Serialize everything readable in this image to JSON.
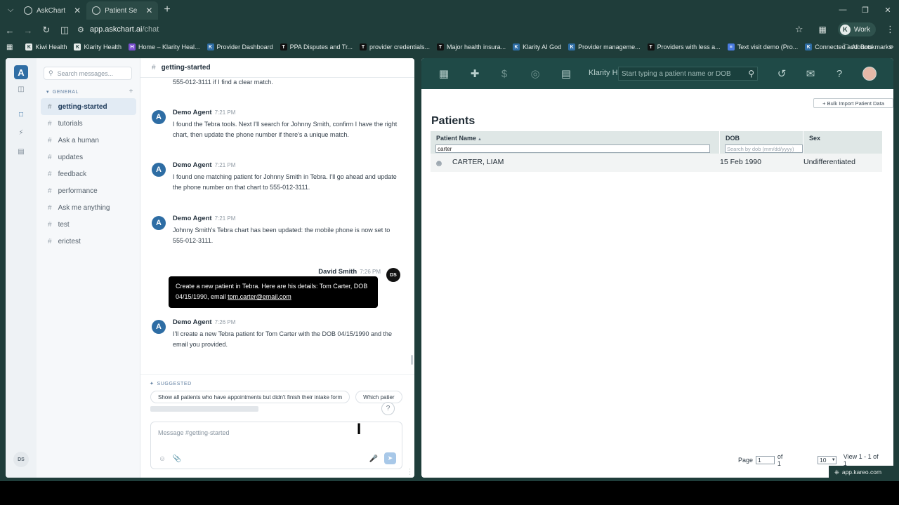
{
  "browser": {
    "tabs": [
      {
        "label": "AskChart",
        "active": false
      },
      {
        "label": "Patient Se",
        "active": true
      }
    ],
    "url_host": "app.askchart.ai",
    "url_path": "/chat",
    "profile_label": "Work",
    "profile_initial": "K",
    "bookmarks": [
      "Kiwi Health",
      "Klarity Health",
      "Home – Klarity Heal...",
      "Provider Dashboard",
      "PPA Disputes and Tr...",
      "provider credentials...",
      "Major health insura...",
      "Klarity AI God",
      "Provider manageme...",
      "Providers with less a...",
      "Text visit demo (Pro...",
      "Connected accounts"
    ],
    "all_bookmarks": "All Bookmarks",
    "status_url": "app.kareo.com"
  },
  "askchart": {
    "logo": "A",
    "user_initials": "DS",
    "search_placeholder": "Search messages...",
    "group_label": "GENERAL",
    "channels": [
      {
        "name": "getting-started",
        "active": true
      },
      {
        "name": "tutorials",
        "active": false
      },
      {
        "name": "Ask a human",
        "active": false
      },
      {
        "name": "updates",
        "active": false
      },
      {
        "name": "feedback",
        "active": false
      },
      {
        "name": "performance",
        "active": false
      },
      {
        "name": "Ask me anything",
        "active": false
      },
      {
        "name": "test",
        "active": false
      },
      {
        "name": "erictest",
        "active": false
      }
    ],
    "channel_title": "getting-started",
    "fragment": "555-012-3111 if I find a clear match.",
    "messages": [
      {
        "author": "Demo Agent",
        "time": "7:21 PM",
        "text": "I found the Tebra tools. Next I'll search for Johnny Smith, confirm I have the right chart, then update the phone number if there's a unique match."
      },
      {
        "author": "Demo Agent",
        "time": "7:21 PM",
        "text": "I found one matching patient for Johnny Smith in Tebra. I'll go ahead and update the phone number on that chart to 555-012-3111."
      },
      {
        "author": "Demo Agent",
        "time": "7:21 PM",
        "text": "Johnny Smith's Tebra chart has been updated: the mobile phone is now set to 555-012-3111."
      },
      {
        "author": "Demo Agent",
        "time": "7:26 PM",
        "text": "I'll create a new Tebra patient for Tom Carter with the DOB 04/15/1990 and the email you provided."
      }
    ],
    "user_message": {
      "author": "David Smith",
      "time": "7:26 PM",
      "text": "Create a new patient in Tebra. Here are his details: Tom Carter, DOB 04/15/1990, email ",
      "link": "tom.carter@email.com"
    },
    "suggested_label": "SUGGESTED",
    "suggestions": [
      "Show all patients who have appointments but didn't finish their intake form",
      "Which patier"
    ],
    "composer_placeholder": "Message #getting-started"
  },
  "kareo": {
    "brand": "Klarity H",
    "search_placeholder": "Start typing a patient name or DOB",
    "bulk_import": "+ Bulk Import Patient Data",
    "page_title": "Patients",
    "columns": [
      {
        "label": "Patient Name",
        "filter": "carter"
      },
      {
        "label": "DOB",
        "filter_placeholder": "Search by dob (mm/dd/yyyy)"
      },
      {
        "label": "Sex"
      }
    ],
    "rows": [
      {
        "name": "CARTER, LIAM",
        "dob": "15 Feb 1990",
        "sex": "Undifferentiated"
      }
    ],
    "pager": {
      "page_label": "Page",
      "page_value": "1",
      "of_label": "of 1",
      "page_size": "10",
      "view_label": "View 1 - 1 of 1"
    }
  }
}
